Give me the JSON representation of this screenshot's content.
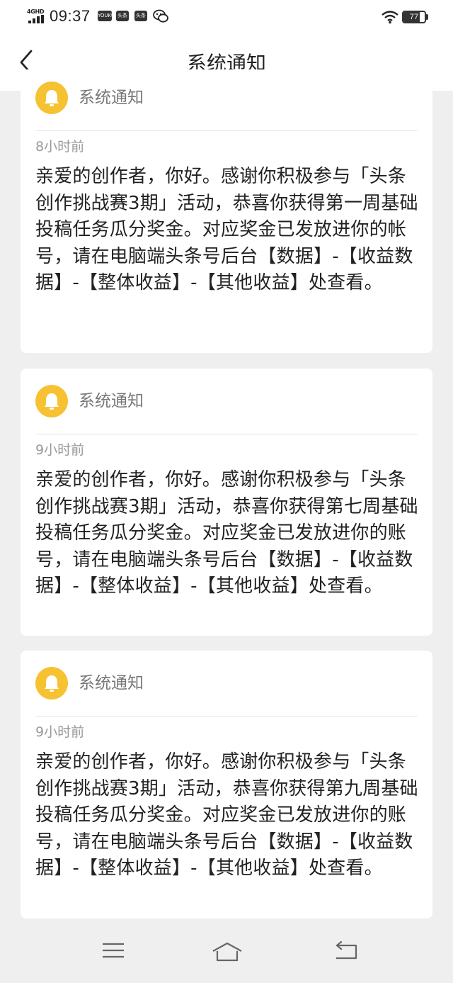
{
  "status_bar": {
    "network_type": "4GHD",
    "time": "09:37",
    "apps": [
      "YOUKU",
      "头条",
      "头条"
    ],
    "battery_level": 77,
    "battery_text": "77"
  },
  "header": {
    "title": "系统通知"
  },
  "notifications": [
    {
      "sender": "系统通知",
      "time_ago": "8小时前",
      "message": "亲爱的创作者，你好。感谢你积极参与「头条创作挑战赛3期」活动，恭喜你获得第一周基础投稿任务瓜分奖金。对应奖金已发放进你的帐号，请在电脑端头条号后台【数据】-【收益数据】-【整体收益】-【其他收益】处查看。"
    },
    {
      "sender": "系统通知",
      "time_ago": "9小时前",
      "message": "亲爱的创作者，你好。感谢你积极参与「头条创作挑战赛3期」活动，恭喜你获得第七周基础投稿任务瓜分奖金。对应奖金已发放进你的账号，请在电脑端头条号后台【数据】-【收益数据】-【整体收益】-【其他收益】处查看。"
    },
    {
      "sender": "系统通知",
      "time_ago": "9小时前",
      "message": "亲爱的创作者，你好。感谢你积极参与「头条创作挑战赛3期」活动，恭喜你获得第九周基础投稿任务瓜分奖金。对应奖金已发放进你的账号，请在电脑端头条号后台【数据】-【收益数据】-【整体收益】-【其他收益】处查看。"
    }
  ],
  "colors": {
    "background": "#efefef",
    "card": "#ffffff",
    "bell": "#f6c232",
    "text": "#222222",
    "muted": "#9a9a9a"
  },
  "icons": [
    "back-arrow-icon",
    "bell-icon",
    "menu-icon",
    "home-icon",
    "back-icon",
    "wifi-icon",
    "battery-icon",
    "wechat-icon"
  ]
}
